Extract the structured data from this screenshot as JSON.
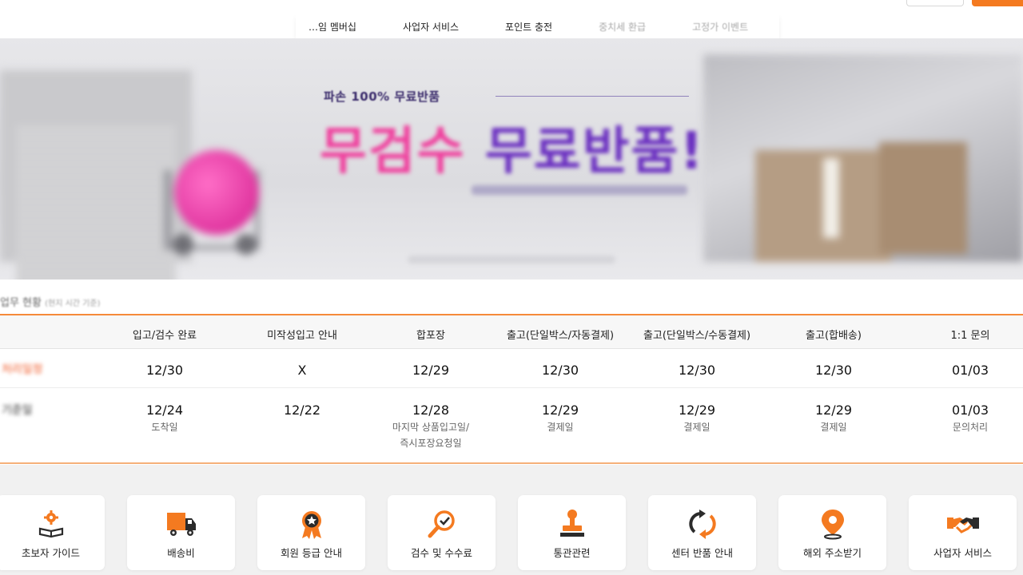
{
  "nav": {
    "items": [
      {
        "label": "…임 멤버십",
        "faded": false
      },
      {
        "label": "사업자 서비스",
        "faded": false
      },
      {
        "label": "포인트 충전",
        "faded": false
      },
      {
        "label": "중치세 환급",
        "faded": true
      },
      {
        "label": "고정가 이벤트",
        "faded": true
      }
    ]
  },
  "banner": {
    "subtitle": "파손 100% 무료반품",
    "headline_pink": "무검수 ",
    "headline_purple": "무료반품!"
  },
  "status": {
    "title_prefix": "",
    "title": "업무 현황",
    "title_note": "(현지 시간 기준)",
    "columns": [
      "입고/검수 완료",
      "미작성입고 안내",
      "합포장",
      "출고(단일박스/자동결제)",
      "출고(단일박스/수동결제)",
      "출고(합배송)",
      "1:1 문의"
    ],
    "rows": [
      {
        "label": "처리일정",
        "sublabel": "",
        "cells": [
          {
            "value": "12/30",
            "note": ""
          },
          {
            "value": "X",
            "note": ""
          },
          {
            "value": "12/29",
            "note": ""
          },
          {
            "value": "12/30",
            "note": ""
          },
          {
            "value": "12/30",
            "note": ""
          },
          {
            "value": "12/30",
            "note": ""
          },
          {
            "value": "01/03",
            "note": ""
          }
        ]
      },
      {
        "label": "기준일",
        "sublabel": "",
        "cells": [
          {
            "value": "12/24",
            "note": "도착일"
          },
          {
            "value": "12/22",
            "note": ""
          },
          {
            "value": "12/28",
            "note": "마지막 상품입고일/\n즉시포장요청일"
          },
          {
            "value": "12/29",
            "note": "결제일"
          },
          {
            "value": "12/29",
            "note": "결제일"
          },
          {
            "value": "12/29",
            "note": "결제일"
          },
          {
            "value": "01/03",
            "note": "문의처리"
          }
        ]
      }
    ]
  },
  "quick_menu": [
    {
      "label": "초보자 가이드",
      "icon": "book-gear-icon"
    },
    {
      "label": "배송비",
      "icon": "truck-icon"
    },
    {
      "label": "회원 등급 안내",
      "icon": "medal-icon"
    },
    {
      "label": "검수 및 수수료",
      "icon": "magnifier-check-icon"
    },
    {
      "label": "통관관련",
      "icon": "stamp-icon"
    },
    {
      "label": "센터 반품 안내",
      "icon": "return-arrows-icon"
    },
    {
      "label": "해외 주소받기",
      "icon": "location-pin-icon"
    },
    {
      "label": "사업자 서비스",
      "icon": "handshake-icon"
    }
  ],
  "colors": {
    "accent_orange": "#f47a20",
    "icon_dark": "#2b2b2b",
    "banner_pink": "#ef3f9d",
    "banner_purple": "#6a2fc0"
  }
}
